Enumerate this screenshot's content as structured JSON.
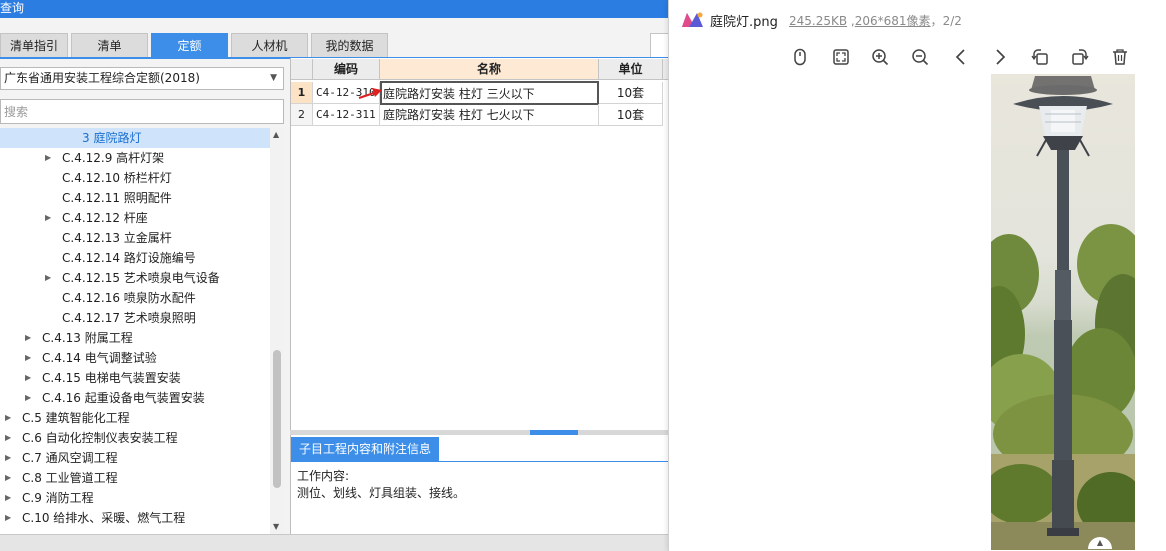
{
  "window": {
    "title": "查询"
  },
  "tabs": [
    {
      "label": "清单指引",
      "active": false
    },
    {
      "label": "清单",
      "active": false
    },
    {
      "label": "定额",
      "active": true
    },
    {
      "label": "人材机",
      "active": false
    },
    {
      "label": "我的数据",
      "active": false
    }
  ],
  "quota_library": {
    "selected": "广东省通用安装工程综合定额(2018)"
  },
  "search": {
    "placeholder": "搜索"
  },
  "tree": {
    "items": [
      {
        "label": "3 庭院路灯",
        "selected": true,
        "expandable": false
      },
      {
        "label": "C.4.12.9 高杆灯架",
        "selected": false,
        "expandable": true
      },
      {
        "label": "C.4.12.10 桥栏杆灯",
        "selected": false,
        "expandable": false
      },
      {
        "label": "C.4.12.11 照明配件",
        "selected": false,
        "expandable": false
      },
      {
        "label": "C.4.12.12 杆座",
        "selected": false,
        "expandable": true
      },
      {
        "label": "C.4.12.13 立金属杆",
        "selected": false,
        "expandable": false
      },
      {
        "label": "C.4.12.14 路灯设施编号",
        "selected": false,
        "expandable": false
      },
      {
        "label": "C.4.12.15 艺术喷泉电气设备",
        "selected": false,
        "expandable": true
      },
      {
        "label": "C.4.12.16 喷泉防水配件",
        "selected": false,
        "expandable": false
      },
      {
        "label": "C.4.12.17 艺术喷泉照明",
        "selected": false,
        "expandable": false
      },
      {
        "label": "C.4.13 附属工程",
        "selected": false,
        "expandable": true
      },
      {
        "label": "C.4.14 电气调整试验",
        "selected": false,
        "expandable": true
      },
      {
        "label": "C.4.15 电梯电气装置安装",
        "selected": false,
        "expandable": true
      },
      {
        "label": "C.4.16 起重设备电气装置安装",
        "selected": false,
        "expandable": true
      },
      {
        "label": "C.5 建筑智能化工程",
        "selected": false,
        "expandable": true
      },
      {
        "label": "C.6 自动化控制仪表安装工程",
        "selected": false,
        "expandable": true
      },
      {
        "label": "C.7 通风空调工程",
        "selected": false,
        "expandable": true
      },
      {
        "label": "C.8 工业管道工程",
        "selected": false,
        "expandable": true
      },
      {
        "label": "C.9 消防工程",
        "selected": false,
        "expandable": true
      },
      {
        "label": "C.10 给排水、采暖、燃气工程",
        "selected": false,
        "expandable": true
      }
    ]
  },
  "grid": {
    "columns": [
      "编码",
      "名称",
      "单位"
    ],
    "rows": [
      {
        "num": "1",
        "code": "C4-12-310",
        "name": "庭院路灯安装 柱灯 三火以下",
        "unit": "10套",
        "selected": true
      },
      {
        "num": "2",
        "code": "C4-12-311",
        "name": "庭院路灯安装 柱灯 七火以下",
        "unit": "10套",
        "selected": false
      }
    ]
  },
  "info_panel": {
    "tab_label": "子目工程内容和附注信息",
    "work_label": "工作内容:",
    "work_content": "测位、划线、灯具组装、接线。"
  },
  "viewer": {
    "filename": "庭院灯.png",
    "filesize": "245.25KB",
    "dimensions": "206*681像素",
    "separator": "，",
    "page": "2/2",
    "toolbar_icons": [
      "mouse-icon",
      "fit-screen-icon",
      "zoom-in-icon",
      "zoom-out-icon",
      "prev-icon",
      "next-icon",
      "rotate-left-icon",
      "rotate-right-icon",
      "delete-icon"
    ]
  },
  "colors": {
    "accent": "#3c8ee8",
    "titlebar": "#2b7de2",
    "tree_selected_bg": "#cfe4fb",
    "header_highlight": "#fde9d4",
    "arrow_red": "#e02020"
  }
}
